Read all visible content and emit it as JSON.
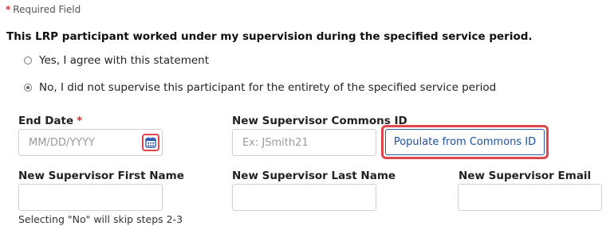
{
  "required_note": {
    "star": "*",
    "text": "Required Field"
  },
  "question": "This LRP participant worked under my supervision during the specified service period.",
  "options": [
    {
      "label": "Yes, I agree with this statement",
      "checked": false
    },
    {
      "label": "No, I did not supervise this participant for the entirety of the specified service period",
      "checked": true
    }
  ],
  "end_date": {
    "label": "End Date",
    "star": "*",
    "placeholder": "MM/DD/YYYY"
  },
  "commons_id": {
    "label": "New Supervisor Commons ID",
    "placeholder": "Ex: JSmith21",
    "button_label": "Populate from Commons ID"
  },
  "first_name": {
    "label": "New Supervisor First Name",
    "value": ""
  },
  "last_name": {
    "label": "New Supervisor Last Name",
    "value": ""
  },
  "email": {
    "label": "New Supervisor Email",
    "value": ""
  },
  "hint": "Selecting \"No\" will skip steps 2-3",
  "colors": {
    "required_star": "#d32f2f",
    "highlight_border": "#e0474c",
    "button_text": "#1d4f9c",
    "calendar_icon": "#2a5db0"
  },
  "icons": {
    "calendar": "calendar-icon"
  }
}
